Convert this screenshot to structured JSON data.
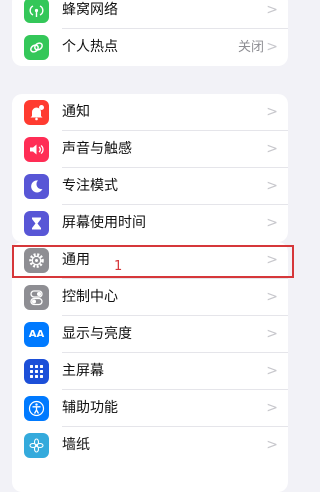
{
  "groups": [
    {
      "items": [
        {
          "label": "蜂窝网络",
          "icon": "cellular-antenna-icon",
          "color": "#34c759",
          "value": ""
        },
        {
          "label": "个人热点",
          "icon": "personal-hotspot-link-icon",
          "color": "#34c759",
          "value": "关闭"
        }
      ]
    },
    {
      "items": [
        {
          "label": "通知",
          "icon": "bell-badge-icon",
          "color": "#ff3b30"
        },
        {
          "label": "声音与触感",
          "icon": "speaker-icon",
          "color": "#ff2d55"
        },
        {
          "label": "专注模式",
          "icon": "moon-icon",
          "color": "#5856d6"
        },
        {
          "label": "屏幕使用时间",
          "icon": "hourglass-icon",
          "color": "#5856d6"
        }
      ]
    },
    {
      "items": [
        {
          "label": "通用",
          "icon": "gear-icon",
          "color": "#8e8e93"
        },
        {
          "label": "控制中心",
          "icon": "toggle-switches-icon",
          "color": "#8e8e93"
        },
        {
          "label": "显示与亮度",
          "icon": "aa-text-icon",
          "color": "#007aff"
        },
        {
          "label": "主屏幕",
          "icon": "app-grid-icon",
          "color": "#1c4fd8"
        },
        {
          "label": "辅助功能",
          "icon": "accessibility-person-icon",
          "color": "#007aff"
        },
        {
          "label": "墙纸",
          "icon": "flower-icon",
          "color": "#34aadc"
        }
      ]
    }
  ],
  "highlight": {
    "color": "#d6373a",
    "label": "1"
  },
  "chevron": ">",
  "aa_glyph": "AA"
}
